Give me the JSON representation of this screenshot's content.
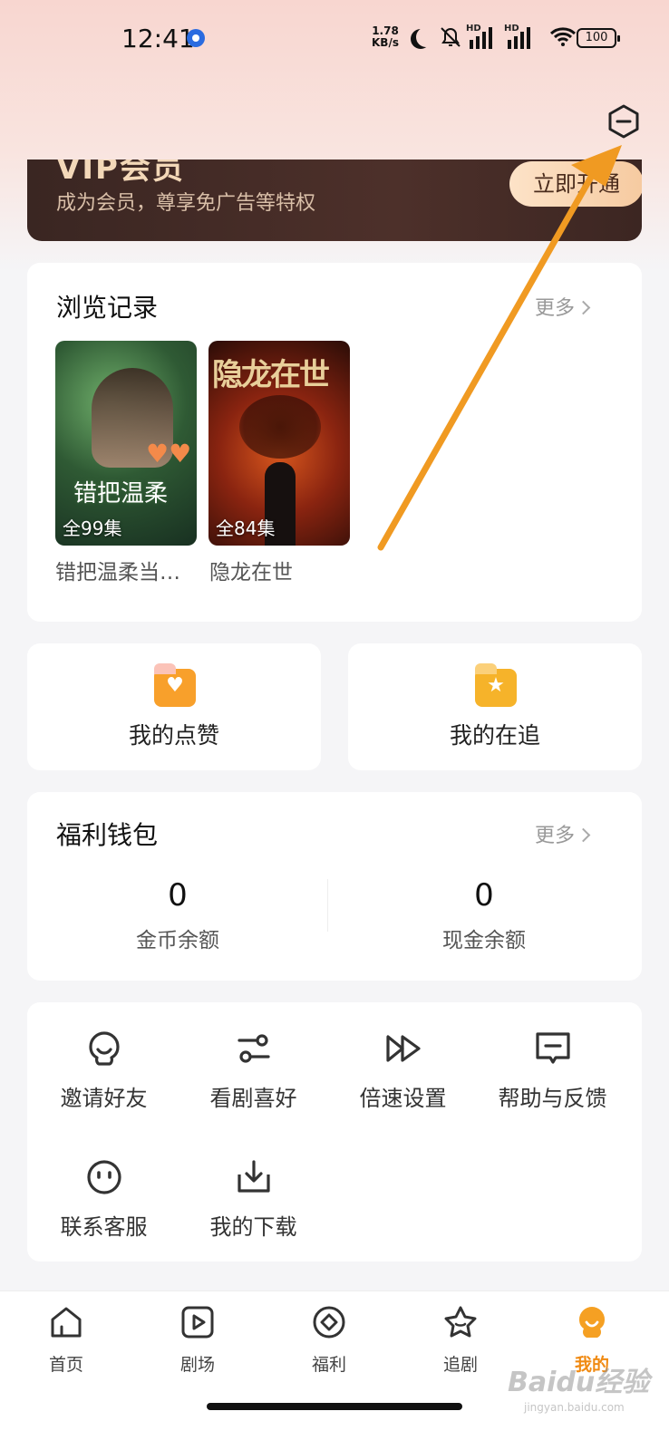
{
  "status_bar": {
    "time": "12:41",
    "net_speed_value": "1.78",
    "net_speed_unit": "KB/s",
    "signal_label_1": "HD",
    "signal_label_2": "HD",
    "battery": "100"
  },
  "vip": {
    "title": "VIP会员",
    "subtitle": "成为会员，尊享免广告等特权",
    "button": "立即开通"
  },
  "history": {
    "title": "浏览记录",
    "more": "更多",
    "items": [
      {
        "poster_title": "错把温柔",
        "episodes": "全99集",
        "caption": "错把温柔当…"
      },
      {
        "poster_title": "隐龙在世",
        "episodes": "全84集",
        "caption": "隐龙在世"
      }
    ]
  },
  "quick": {
    "likes": "我的点赞",
    "following": "我的在追"
  },
  "wallet": {
    "title": "福利钱包",
    "more": "更多",
    "coins_value": "0",
    "coins_label": "金币余额",
    "cash_value": "0",
    "cash_label": "现金余额"
  },
  "tools": [
    {
      "label": "邀请好友",
      "icon": "invite-icon"
    },
    {
      "label": "看剧喜好",
      "icon": "preference-icon"
    },
    {
      "label": "倍速设置",
      "icon": "speed-icon"
    },
    {
      "label": "帮助与反馈",
      "icon": "feedback-icon"
    },
    {
      "label": "联系客服",
      "icon": "service-icon"
    },
    {
      "label": "我的下载",
      "icon": "download-icon"
    }
  ],
  "nav": [
    {
      "label": "首页",
      "icon": "home-icon"
    },
    {
      "label": "剧场",
      "icon": "play-icon"
    },
    {
      "label": "福利",
      "icon": "coin-icon"
    },
    {
      "label": "追剧",
      "icon": "star-icon"
    },
    {
      "label": "我的",
      "icon": "profile-icon",
      "active": true
    }
  ],
  "watermark": {
    "brand": "Baidu经验",
    "domain": "jingyan.baidu.com"
  },
  "colors": {
    "accent": "#f08a12",
    "vip_bg": "#3a2622",
    "annotation": "#f09a22"
  }
}
